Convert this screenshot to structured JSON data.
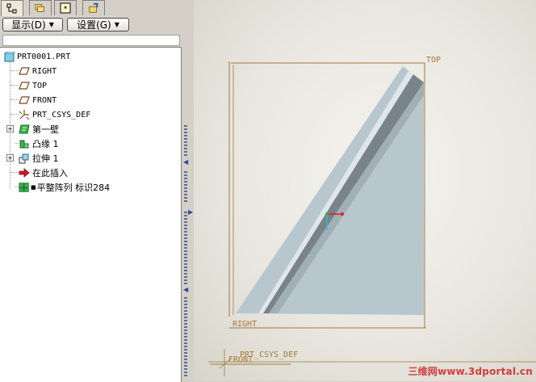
{
  "toolbar": {
    "display_label": "显示(D)",
    "settings_label": "设置(G)"
  },
  "tabs": [
    {
      "icon": "model-tree-icon",
      "active": true
    },
    {
      "icon": "folder-browser-icon",
      "active": false
    },
    {
      "icon": "favorites-icon",
      "active": false
    },
    {
      "icon": "connections-icon",
      "active": false
    }
  ],
  "tree": {
    "root": "PRT0001.PRT",
    "items": [
      {
        "label": "RIGHT",
        "icon": "datum-plane-icon"
      },
      {
        "label": "TOP",
        "icon": "datum-plane-icon"
      },
      {
        "label": "FRONT",
        "icon": "datum-plane-icon"
      },
      {
        "label": "PRT_CSYS_DEF",
        "icon": "coordinate-system-icon"
      },
      {
        "label": "第一壁",
        "icon": "first-wall-icon"
      },
      {
        "label": "凸缘 1",
        "icon": "flange-icon"
      },
      {
        "label": "拉伸 1",
        "icon": "extrude-icon"
      },
      {
        "label": "在此插入",
        "icon": "insert-here-arrow-icon"
      },
      {
        "label": "平整阵列 标识284",
        "icon": "flat-pattern-icon"
      }
    ]
  },
  "viewport": {
    "datum_top": "TOP",
    "datum_right": "RIGHT",
    "datum_front": "FRONT",
    "csys_label": "PRT_CSYS_DEF",
    "watermark": "三维网www.3dportal.cn"
  },
  "colors": {
    "datum": "#a27a3e",
    "part": "#b8c6ce",
    "background": "#e9e7df",
    "watermark": "#d23c3c"
  }
}
